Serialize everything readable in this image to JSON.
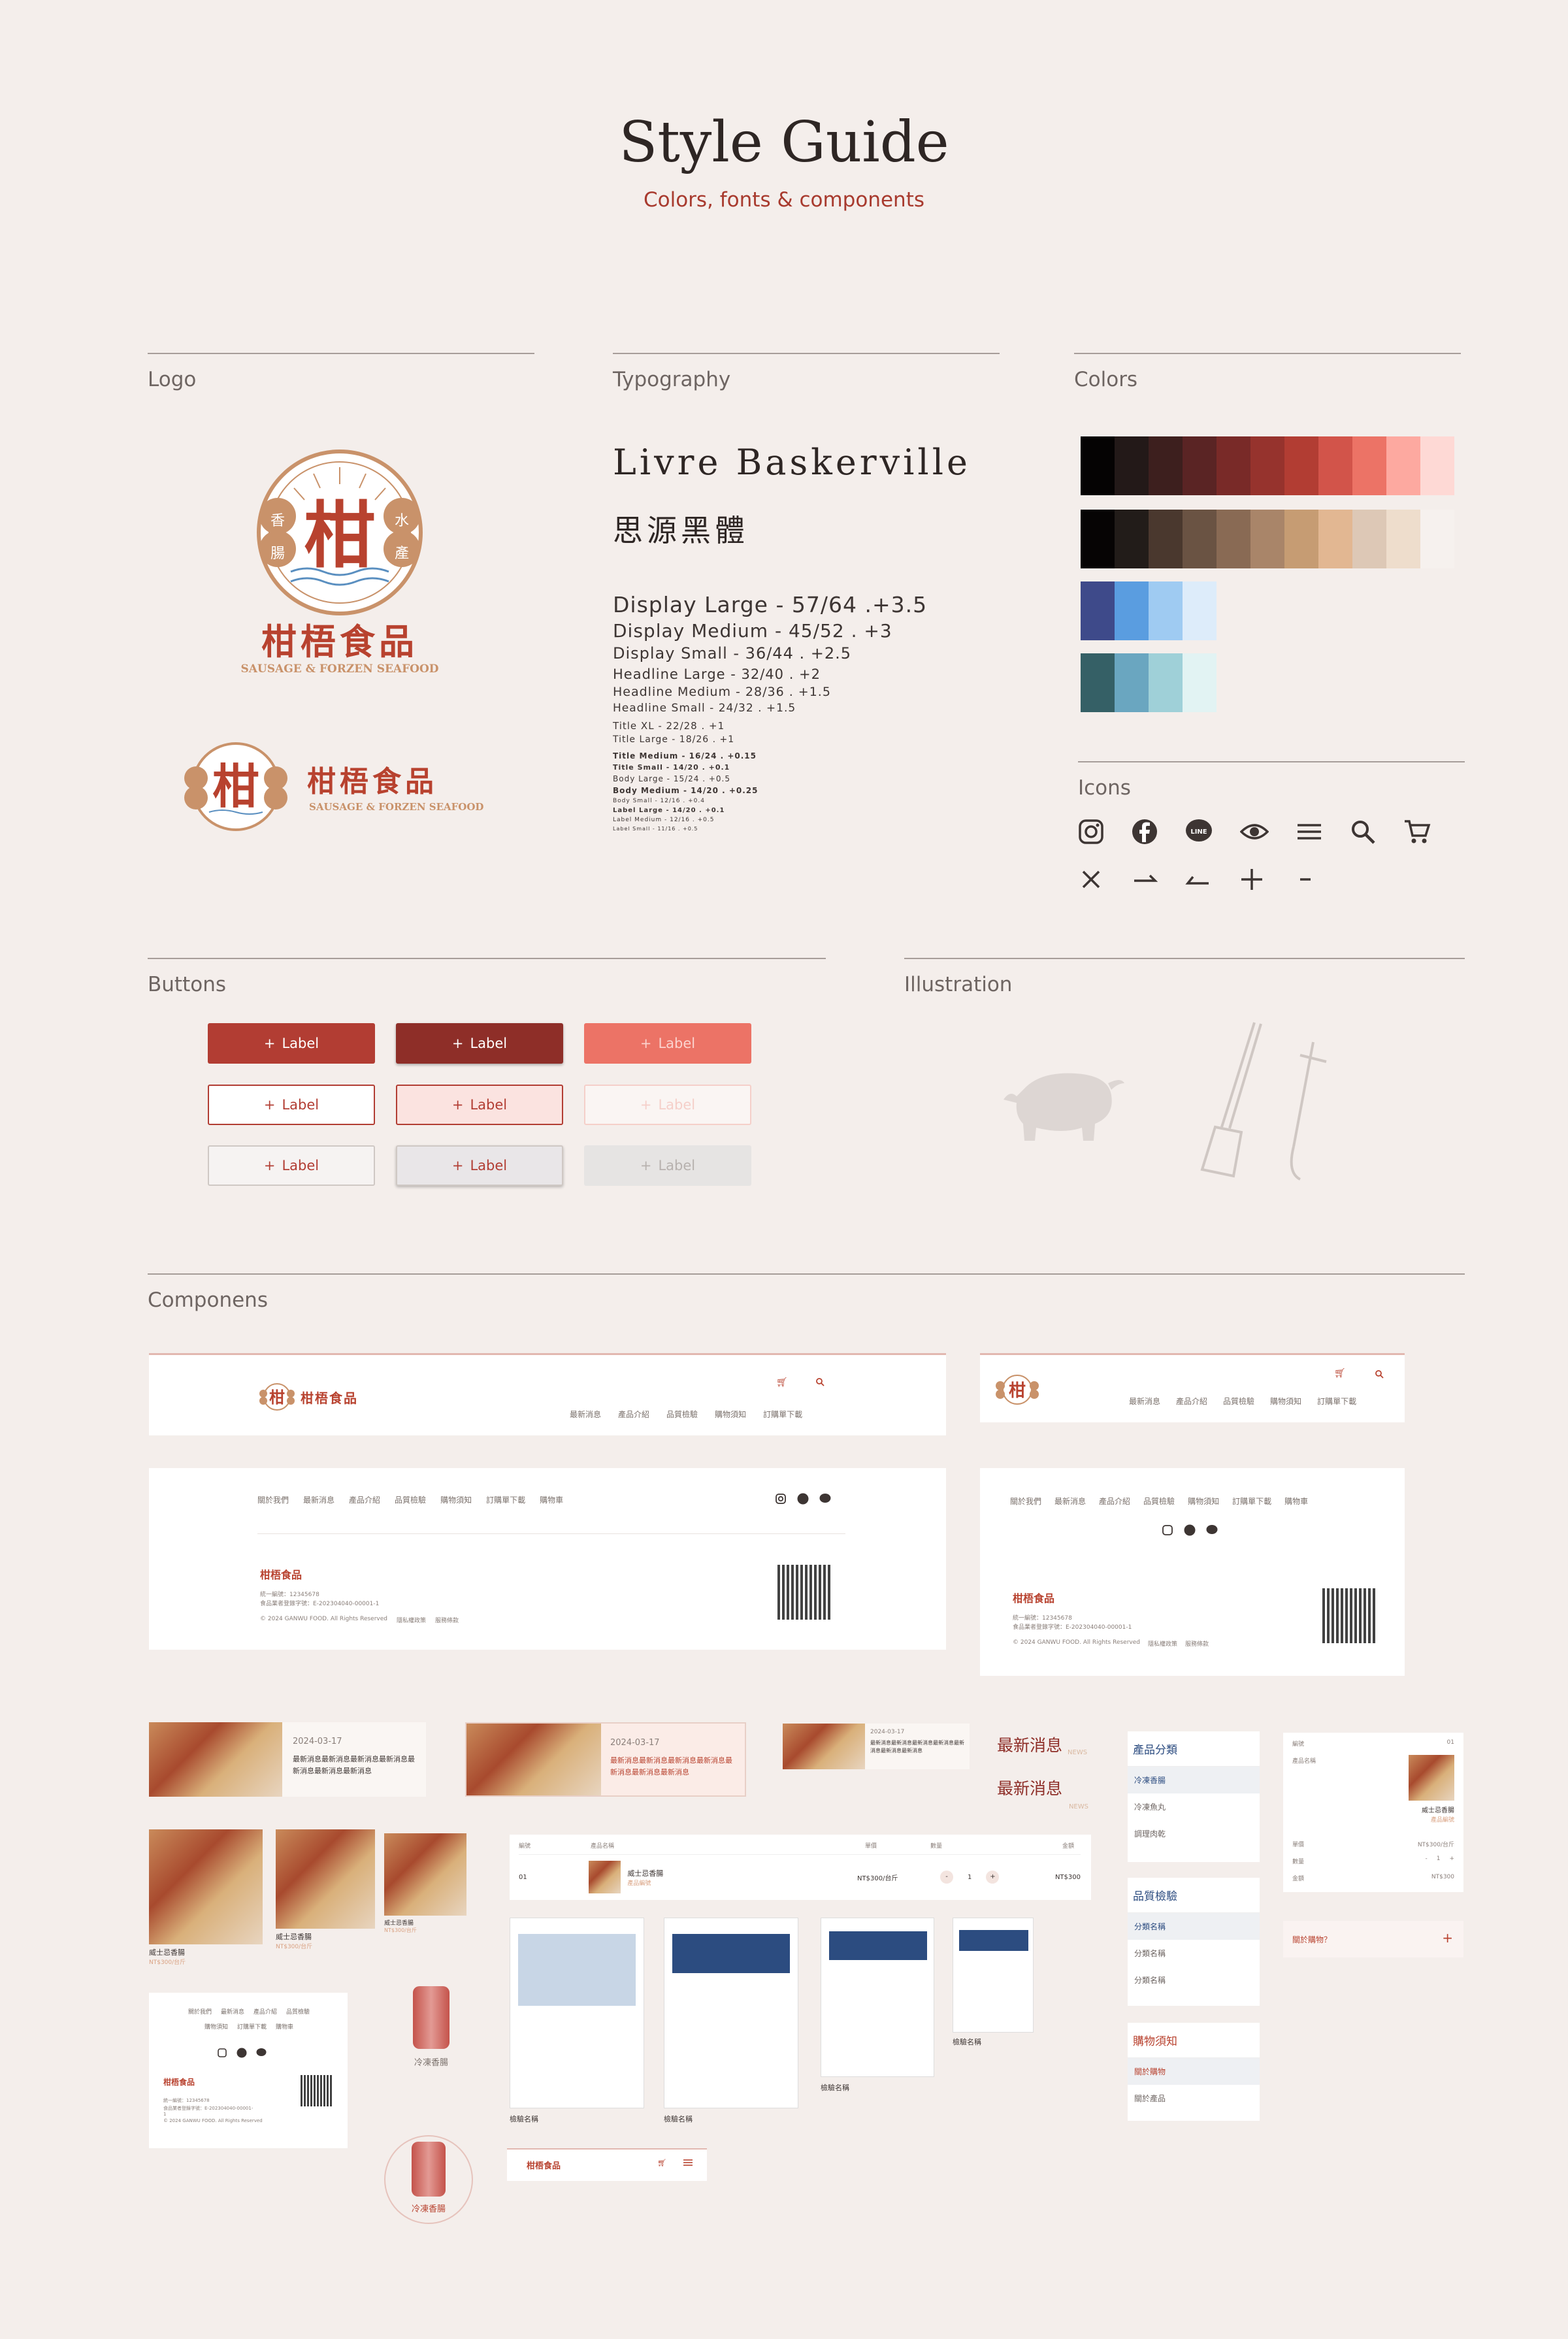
{
  "header": {
    "title": "Style Guide",
    "subtitle": "Colors, fonts  & components"
  },
  "sections": {
    "logo": "Logo",
    "typography": "Typography",
    "colors": "Colors",
    "icons": "Icons",
    "buttons": "Buttons",
    "illustration": "Illustration",
    "components": "Componens"
  },
  "logo": {
    "name": "柑梧食品",
    "tagline": "SAUSAGE & FORZEN SEAFOOD",
    "emblem_char": "柑",
    "emblem_left": "香腸",
    "emblem_right": "水產"
  },
  "typography": {
    "font_latin": "Livre Baskerville",
    "font_cjk": "思源黑體",
    "scale": [
      "Display Large - 57/64 .+3.5",
      "Display Medium - 45/52 .  +3",
      "Display Small - 36/44 . +2.5",
      "Headline Large - 32/40 . +2",
      "Headline Medium - 28/36 . +1.5",
      "Headline Small -  24/32 . +1.5",
      "Title XL - 22/28 . +1",
      "Title Large - 18/26 . +1",
      "Title Medium - 16/24 . +0.15",
      "Title Small - 14/20 . +0.1",
      "Body Large - 15/24 . +0.5",
      "Body Medium - 14/20 . +0.25",
      "Body Small - 12/16 . +0.4",
      "Label Large - 14/20 . +0.1",
      "Label Medium - 12/16 . +0.5",
      "Label Small - 11/16 . +0.5"
    ]
  },
  "colors": {
    "reds": [
      "#050303",
      "#231918",
      "#3d1f1e",
      "#5a2424",
      "#792a28",
      "#96332d",
      "#b23d33",
      "#d2544a",
      "#ec7366",
      "#fda9a0",
      "#fed9d5"
    ],
    "browns": [
      "#060404",
      "#221c19",
      "#4a382e",
      "#6a5343",
      "#896a54",
      "#a98569",
      "#c69c73",
      "#e2b792",
      "#ddc8b6",
      "#eeddcc",
      "#f6f1ee"
    ],
    "blues": [
      "#3e4a8a",
      "#5a9de0",
      "#9fcbf2",
      "#ddecfa"
    ],
    "teals": [
      "#356066",
      "#6aa6c0",
      "#9fd0d8",
      "#e2f3f3"
    ]
  },
  "icons": [
    "instagram-icon",
    "facebook-icon",
    "line-icon",
    "eye-icon",
    "menu-icon",
    "search-icon",
    "cart-icon",
    "close-icon",
    "chevron-right-icon",
    "chevron-left-icon",
    "plus-icon",
    "minus-icon"
  ],
  "icon_text": {
    "line": "LINE"
  },
  "buttons": {
    "label": "Label",
    "plus": "+"
  },
  "nav": {
    "items": [
      "最新消息",
      "產品介紹",
      "品質檢驗",
      "購物須知",
      "訂購單下載"
    ],
    "footer_items": [
      "關於我們",
      "最新消息",
      "產品介紹",
      "品質檢驗",
      "購物須知",
      "訂購單下載",
      "購物車"
    ],
    "copyright": "© 2024 GANWU FOOD. All Rights Reserved",
    "privacy": "隱私權政策",
    "terms": "服務條款",
    "address": "統一編號：12345678",
    "phone": "食品業者登錄字號：E-202304040-00001-1"
  },
  "news": {
    "date": "2024-03-17",
    "text": "最新消息最新消息最新消息最新消息最新消息最新消息最新消息",
    "heading": "最新消息",
    "heading_en": "NEWS"
  },
  "product": {
    "name": "威士忌香腸",
    "price": "NT$300/台斤",
    "total": "NT$300",
    "tag": "產品編號",
    "frozen": "冷凍香腸",
    "report": "檢驗名稱",
    "qty": "1",
    "minus": "-",
    "plus": "+",
    "row_no": "01",
    "col_no": "編號",
    "col_name": "產品名稱",
    "col_price": "單價",
    "col_qty": "數量",
    "col_total": "金額"
  },
  "sidebar": {
    "cat_title": "產品分類",
    "cats": [
      "冷凍香腸",
      "冷凍魚丸",
      "調理肉乾"
    ],
    "qc_title": "品質檢驗",
    "qcs": [
      "分類名稱",
      "分類名稱",
      "分類名稱"
    ],
    "shop_title": "購物須知",
    "shops": [
      "關於購物",
      "關於產品"
    ],
    "faq": "關於購物？",
    "faq_plus": "+"
  }
}
